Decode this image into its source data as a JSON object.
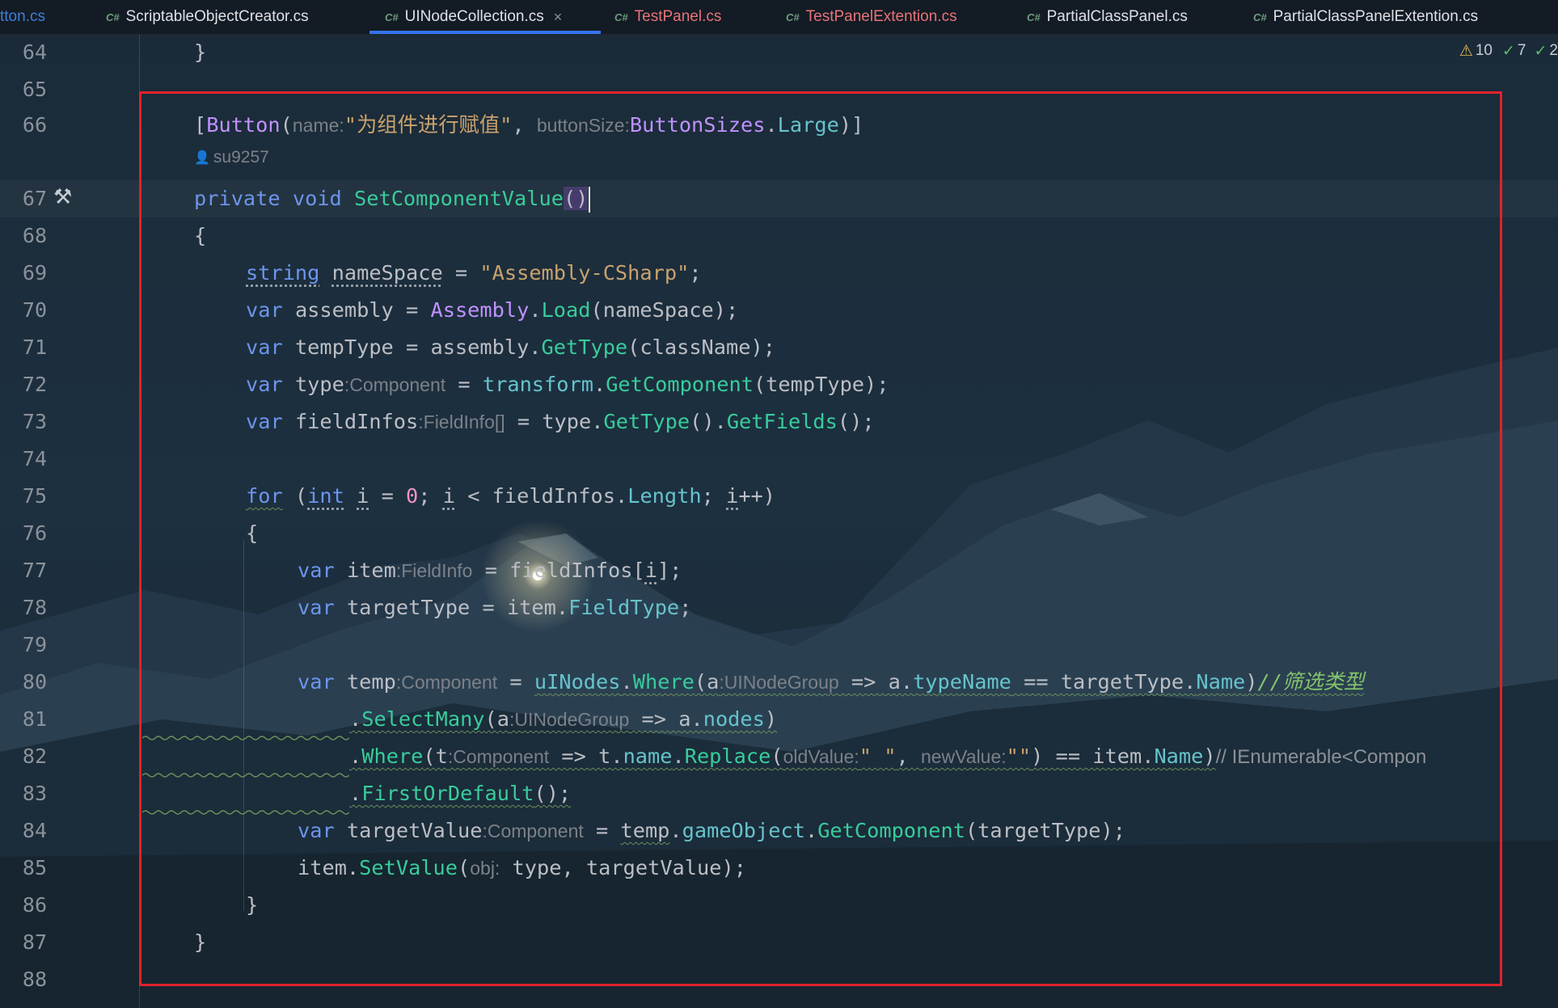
{
  "tabs": [
    {
      "label": "tton.cs",
      "icon": "",
      "style": "normal"
    },
    {
      "label": "ScriptableObjectCreator.cs",
      "icon": "C#",
      "style": "normal"
    },
    {
      "label": "UINodeCollection.cs",
      "icon": "C#",
      "style": "active",
      "close": "×"
    },
    {
      "label": "TestPanel.cs",
      "icon": "C#",
      "style": "red"
    },
    {
      "label": "TestPanelExtention.cs",
      "icon": "C#",
      "style": "red"
    },
    {
      "label": "PartialClassPanel.cs",
      "icon": "C#",
      "style": "normal"
    },
    {
      "label": "PartialClassPanelExtention.cs",
      "icon": "C#",
      "style": "normal"
    }
  ],
  "inspections": {
    "warnings": "10",
    "ok": "7",
    "ok_weak": "2"
  },
  "author": "su9257",
  "colors": {
    "keyword": "#6c95eb",
    "method": "#39cc9b",
    "class": "#c191ff",
    "string": "#c9a26d",
    "property": "#66c3cc",
    "number": "#ed94c0",
    "comment": "#85c46c",
    "highlight_box": "#e0222b",
    "tab_underline": "#3574f0"
  },
  "lines": [
    {
      "num": "64"
    },
    {
      "num": "65"
    },
    {
      "num": "66"
    },
    {
      "num": "67"
    },
    {
      "num": "68"
    },
    {
      "num": "69"
    },
    {
      "num": "70"
    },
    {
      "num": "71"
    },
    {
      "num": "72"
    },
    {
      "num": "73"
    },
    {
      "num": "74"
    },
    {
      "num": "75"
    },
    {
      "num": "76"
    },
    {
      "num": "77"
    },
    {
      "num": "78"
    },
    {
      "num": "79"
    },
    {
      "num": "80"
    },
    {
      "num": "81"
    },
    {
      "num": "82"
    },
    {
      "num": "83"
    },
    {
      "num": "84"
    },
    {
      "num": "85"
    },
    {
      "num": "86"
    },
    {
      "num": "87"
    },
    {
      "num": "88"
    }
  ],
  "code": {
    "l64": {
      "brace": "}"
    },
    "l66": {
      "open": "[",
      "attr": "Button",
      "p1": "(",
      "hint_name": "name:",
      "arg_name": "\"为组件进行赋值\"",
      "comma": ",",
      "hint_size": "buttonSize:",
      "enum": "ButtonSizes",
      "dot": ".",
      "member": "Large",
      "close": ")]"
    },
    "l67": {
      "kw1": "private",
      "kw2": "void",
      "method": "SetComponentValue",
      "parens": "()"
    },
    "l68": {
      "brace": "{"
    },
    "l69": {
      "type": "string",
      "var": "nameSpace",
      "eq": " = ",
      "value": "\"Assembly-CSharp\"",
      "end": ";"
    },
    "l70": {
      "kw": "var",
      "var": "assembly",
      "eq": " = ",
      "cls": "Assembly",
      "dot": ".",
      "fn": "Load",
      "args": "(nameSpace);"
    },
    "l71": {
      "kw": "var",
      "var": "tempType",
      "eq": " = assembly.",
      "fn": "GetType",
      "args": "(className);"
    },
    "l72": {
      "kw": "var",
      "var": "type",
      "hint": ":Component",
      "eq": " = ",
      "obj": "transform",
      "dot": ".",
      "fn": "GetComponent",
      "args": "(tempType);"
    },
    "l73": {
      "kw": "var",
      "var": "fieldInfos",
      "hint": ":FieldInfo[]",
      "eq": " = type.",
      "fn1": "GetType",
      "mid": "().",
      "fn2": "GetFields",
      "end": "();"
    },
    "l75": {
      "kw": "for",
      "p1": " (",
      "type": "int",
      "sp": " ",
      "i1": "i",
      "eq": " = ",
      "zero": "0",
      "sc": "; ",
      "i2": "i",
      "lt": " < fieldInfos.",
      "prop": "Length",
      "sc2": "; ",
      "i3": "i",
      "inc": "++)"
    },
    "l76": {
      "brace": "{"
    },
    "l77": {
      "kw": "var",
      "var": "item",
      "hint": ":FieldInfo",
      "eq": " = fieldInfos[",
      "i": "i",
      "end": "];"
    },
    "l78": {
      "kw": "var",
      "var": "targetType",
      "eq": " = item.",
      "prop": "FieldType",
      "end": ";"
    },
    "l80": {
      "kw": "var",
      "var": "temp",
      "hint": ":Component",
      "eq": " = ",
      "field": "uINodes",
      "dot": ".",
      "fn": "Where",
      "p1": "(a",
      "hint2": ":UINodeGroup",
      "arrow": " => a.",
      "prop": "typeName",
      "cmp": " == targetType.",
      "prop2": "Name",
      "p2": ")",
      "comment": "//筛选类型"
    },
    "l81": {
      "dot": ".",
      "fn": "SelectMany",
      "p1": "(a",
      "hint": ":UINodeGroup",
      "arrow": " => a.",
      "prop": "nodes",
      "p2": ")"
    },
    "l82": {
      "dot": ".",
      "fn": "Where",
      "p1": "(t",
      "hint": ":Component",
      "arrow": " => t.",
      "prop": "name",
      "dot2": ".",
      "fn2": "Replace",
      "p2": "(",
      "hint_old": "oldValue:",
      "arg1": "\" \"",
      "comma": ", ",
      "hint_new": "newValue:",
      "arg2": "\"\"",
      "cmp": ") == item.",
      "prop2": "Name",
      "p3": ")",
      "comment": "// IEnumerable<Compon"
    },
    "l83": {
      "dot": ".",
      "fn": "FirstOrDefault",
      "end": "();"
    },
    "l84": {
      "kw": "var",
      "var": "targetValue",
      "hint": ":Component",
      "eq": " = ",
      "temp": "temp",
      "dot": ".",
      "prop": "gameObject",
      "dot2": ".",
      "fn": "GetComponent",
      "args": "(targetType);"
    },
    "l85": {
      "obj": "item.",
      "fn": "SetValue",
      "p1": "(",
      "hint": "obj:",
      "args": " type, targetValue);"
    },
    "l86": {
      "brace": "}"
    },
    "l87": {
      "brace": "}"
    }
  }
}
